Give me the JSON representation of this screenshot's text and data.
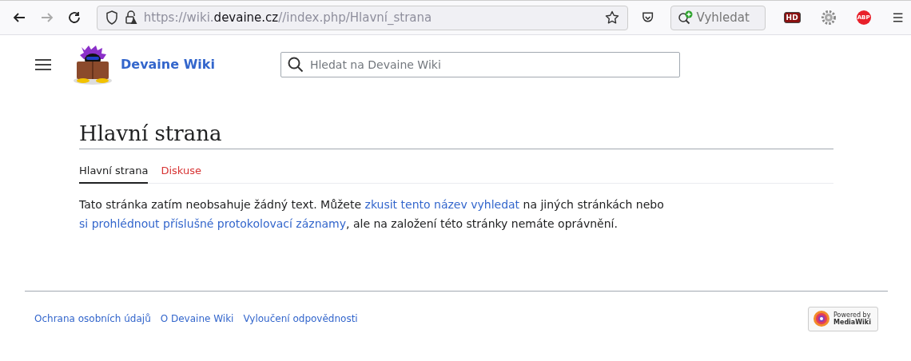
{
  "browser": {
    "back_enabled": true,
    "forward_enabled": false,
    "url": [
      {
        "text": "https://wiki.",
        "emphasized": false
      },
      {
        "text": "devaine.cz",
        "emphasized": true
      },
      {
        "text": "//index.php/Hlavní_strana",
        "emphasized": false
      }
    ],
    "search": {
      "placeholder": "Vyhledat"
    },
    "extensions": [
      {
        "kind": "badge",
        "label": "HD"
      },
      {
        "kind": "gear"
      },
      {
        "kind": "stop",
        "label": "ABP"
      }
    ]
  },
  "site": {
    "name": "Devaine Wiki",
    "search": {
      "placeholder": "Hledat na Devaine Wiki"
    }
  },
  "page": {
    "title": "Hlavní strana",
    "tabs": [
      {
        "label": "Hlavní strana",
        "selected": true,
        "exists": true
      },
      {
        "label": "Diskuse",
        "selected": false,
        "exists": false
      }
    ],
    "message": [
      {
        "kind": "text",
        "text": "Tato stránka zatím neobsahuje žádný text. Můžete "
      },
      {
        "kind": "link",
        "text": "zkusit tento název vyhledat"
      },
      {
        "kind": "text",
        "text": " na jiných stránkách nebo "
      },
      {
        "kind": "link",
        "text": "si prohlédnout příslušné protokolovací záznamy"
      },
      {
        "kind": "text",
        "text": ", ale na založení této stránky nemáte oprávnění."
      }
    ]
  },
  "footer": {
    "links": [
      "Ochrana osobních údajů",
      "O Devaine Wiki",
      "Vyloučení odpovědnosti"
    ],
    "badge": {
      "line_1": "Powered by",
      "line_2": "MediaWiki"
    }
  }
}
